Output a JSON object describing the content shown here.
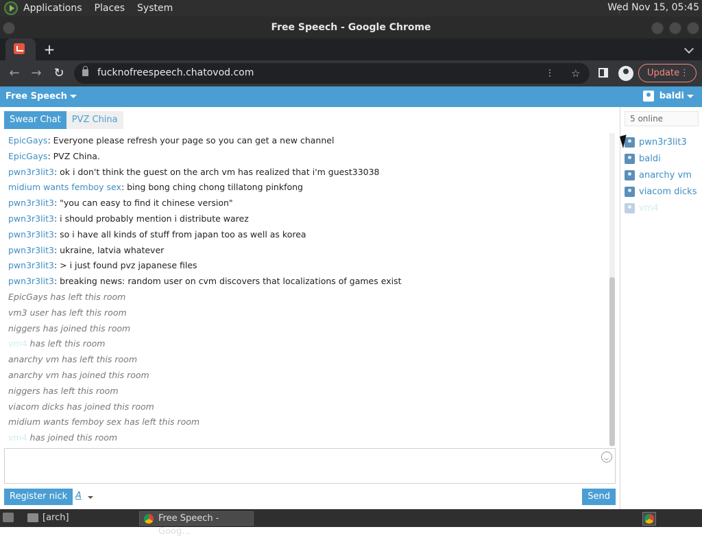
{
  "system_panel": {
    "menus": [
      "Applications",
      "Places",
      "System"
    ],
    "clock": "Wed Nov 15, 05:45"
  },
  "window": {
    "title": "Free Speech - Google Chrome"
  },
  "browser": {
    "new_tab_symbol": "+",
    "url": "fucknofreespeech.chatovod.com",
    "update_label": "Update"
  },
  "app": {
    "room_name": "Free Speech",
    "username": "baldi",
    "tabs": [
      "Swear Chat",
      "PVZ China"
    ],
    "messages": [
      {
        "nick": "EpicGays",
        "text": "Everyone please refresh your page so you can get a new channel"
      },
      {
        "nick": "EpicGays",
        "text": "PVZ China."
      },
      {
        "nick": "pwn3r3lit3",
        "text": "ok i don't think the guest on the arch vm has realized that i'm guest33038"
      },
      {
        "nick": "midium wants femboy sex",
        "text": "bing bong ching chong tillatong pinkfong"
      },
      {
        "nick": "pwn3r3lit3",
        "text": "\"you can easy to find it chinese version\""
      },
      {
        "nick": "pwn3r3lit3",
        "text": "i should probably mention i distribute warez"
      },
      {
        "nick": "pwn3r3lit3",
        "text": "so i have all kinds of stuff from japan too as well as korea"
      },
      {
        "nick": "pwn3r3lit3",
        "text": "ukraine, latvia whatever"
      },
      {
        "nick": "pwn3r3lit3",
        "text": "> i just found pvz japanese files"
      },
      {
        "nick": "pwn3r3lit3",
        "text": "breaking news: random user on cvm discovers that localizations of games exist"
      }
    ],
    "events": [
      {
        "who": "EpicGays",
        "text": "has left this room"
      },
      {
        "who": "vm3 user",
        "text": "has left this room"
      },
      {
        "who": "niggers",
        "text": "has joined this room"
      },
      {
        "who": "vm4",
        "text": "has left this room"
      },
      {
        "who": "anarchy vm",
        "text": "has left this room"
      },
      {
        "who": "anarchy vm",
        "text": "has joined this room"
      },
      {
        "who": "niggers",
        "text": "has left this room"
      },
      {
        "who": "viacom dicks",
        "text": "has joined this room"
      },
      {
        "who": "midium wants femboy sex",
        "text": "has left this room"
      },
      {
        "who": "vm4",
        "text": "has joined this room"
      }
    ],
    "register_label": "Register nick",
    "format_label": "A",
    "send_label": "Send",
    "online_count": "5 online",
    "users": [
      "pwn3r3lit3",
      "baldi",
      "anarchy vm",
      "viacom dicks",
      "vm4"
    ]
  },
  "taskbar": {
    "tasks": [
      "[arch]",
      "Free Speech - Goog..."
    ]
  }
}
